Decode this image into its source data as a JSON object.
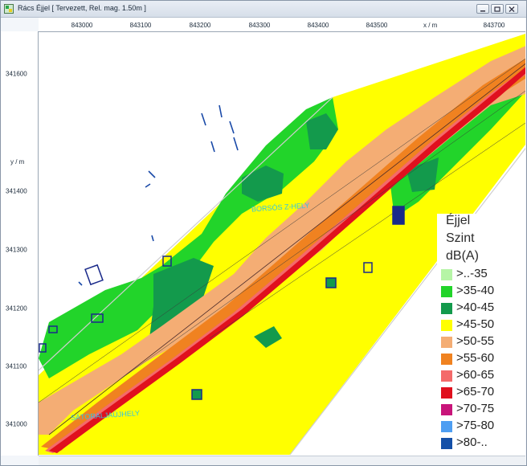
{
  "window": {
    "title": "Rács Éjjel  [ Tervezett, Rel. mag. 1.50m ]",
    "buttons": [
      "minimize",
      "maximize",
      "close"
    ]
  },
  "axes": {
    "x_label": "x / m",
    "y_label": "y / m",
    "x_ticks": [
      "843000",
      "843100",
      "843200",
      "843300",
      "843400",
      "843500",
      "843700"
    ],
    "y_ticks": [
      "341600",
      "341400",
      "341300",
      "341200",
      "341100",
      "341000"
    ]
  },
  "map": {
    "place_labels": [
      "BORSÓS Z-HELY",
      "SÁTORALJAÚJHELY"
    ]
  },
  "legend": {
    "title_lines": [
      "Éjjel",
      "Szint",
      "dB(A)"
    ],
    "items": [
      {
        "label": ">..-35",
        "color": "#b6f5a6"
      },
      {
        "label": ">35-40",
        "color": "#22d42a"
      },
      {
        "label": ">40-45",
        "color": "#139a4c"
      },
      {
        "label": ">45-50",
        "color": "#ffff00"
      },
      {
        "label": ">50-55",
        "color": "#f4ad74"
      },
      {
        "label": ">55-60",
        "color": "#f08220"
      },
      {
        "label": ">60-65",
        "color": "#f46a6a"
      },
      {
        "label": ">65-70",
        "color": "#e0101e"
      },
      {
        "label": ">70-75",
        "color": "#c8147a"
      },
      {
        "label": ">75-80",
        "color": "#4e9ef2"
      },
      {
        "label": ">80-..",
        "color": "#1450a8"
      }
    ]
  }
}
